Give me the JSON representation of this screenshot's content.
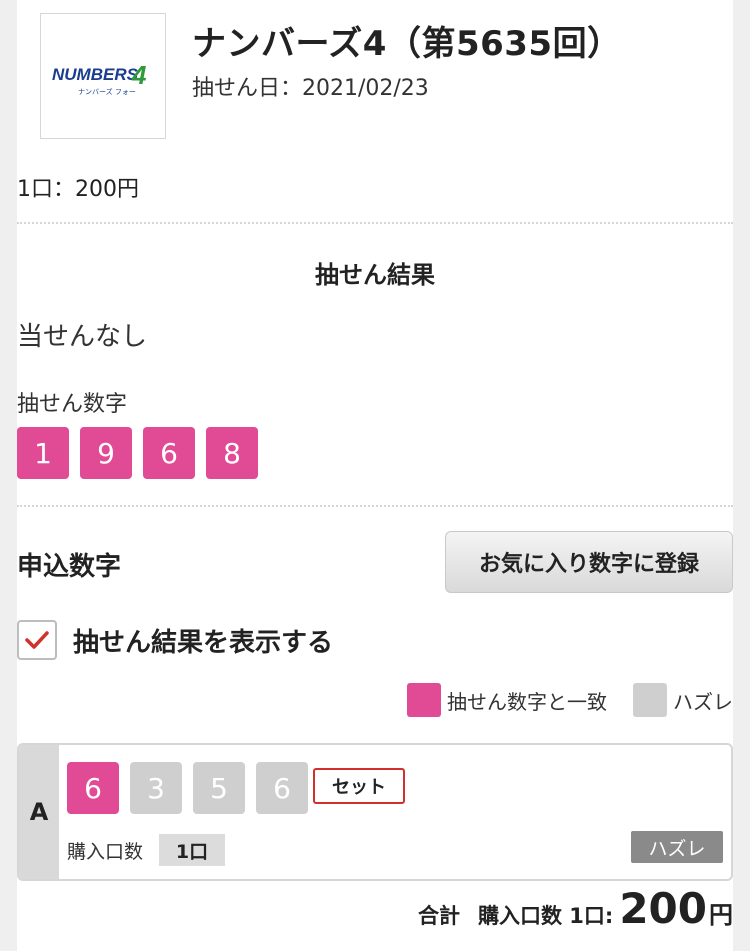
{
  "header": {
    "logo_text": "NUMBERS4",
    "logo_sub": "ナンバーズ フォー",
    "title": "ナンバーズ4（第5635回）",
    "date": "抽せん日：2021/02/23"
  },
  "price": "1口：200円",
  "result": {
    "section_title": "抽せん結果",
    "status": "当せんなし",
    "numbers_label": "抽せん数字",
    "numbers": [
      "1",
      "9",
      "6",
      "8"
    ]
  },
  "apply": {
    "title": "申込数字",
    "fav_button": "お気に入り数字に登録",
    "show_results_label": "抽せん結果を表示する",
    "show_results_checked": true,
    "legend": {
      "match": "抽せん数字と一致",
      "miss": "ハズレ",
      "match_color": "#e14a94",
      "miss_color": "#cfcfcf"
    },
    "tickets": [
      {
        "id": "A",
        "numbers": [
          {
            "value": "6",
            "match": true
          },
          {
            "value": "3",
            "match": false
          },
          {
            "value": "5",
            "match": false
          },
          {
            "value": "6",
            "match": false
          }
        ],
        "type_badge": "セット",
        "qty_label": "購入口数",
        "qty": "1口",
        "result_badge": "ハズレ"
      }
    ]
  },
  "total": {
    "label": "合計",
    "qty_text": "購入口数 1口:",
    "amount": "200",
    "unit": "円"
  }
}
